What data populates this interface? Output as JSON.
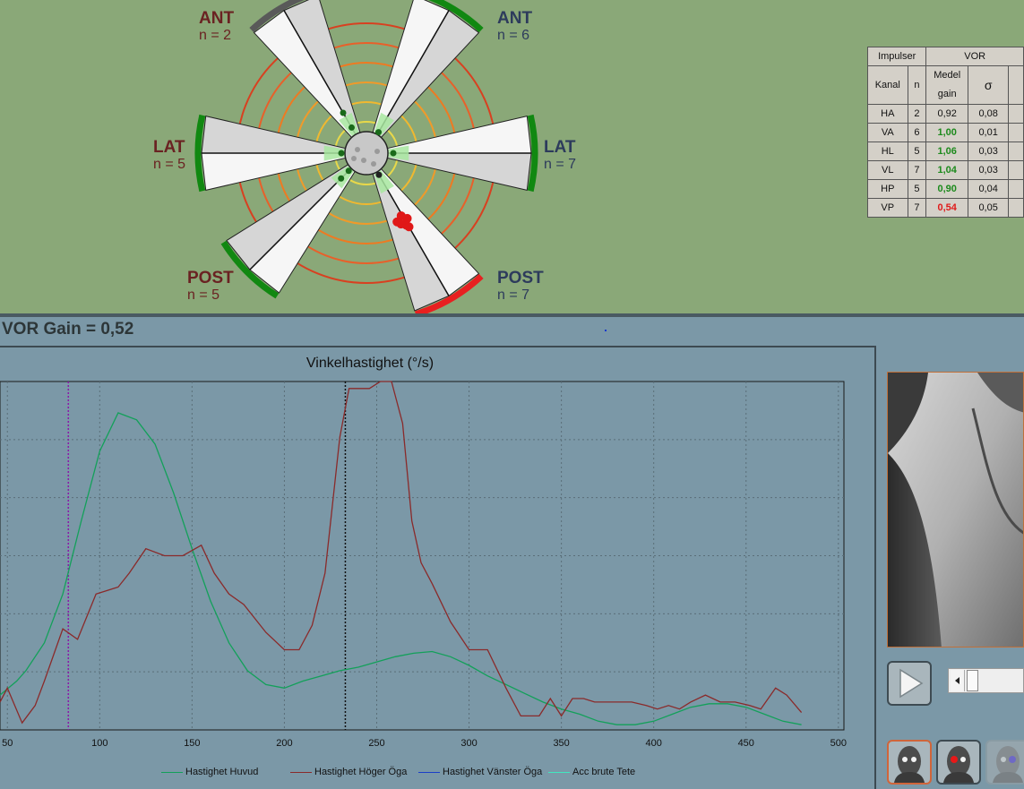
{
  "radar": {
    "labels": [
      {
        "name": "ANT",
        "n": "n = 2",
        "tone": "red"
      },
      {
        "name": "ANT",
        "n": "n = 6",
        "tone": "blue"
      },
      {
        "name": "LAT",
        "n": "n = 5",
        "tone": "red"
      },
      {
        "name": "LAT",
        "n": "n = 7",
        "tone": "blue"
      },
      {
        "name": "POST",
        "n": "n = 5",
        "tone": "red"
      },
      {
        "name": "POST",
        "n": "n = 7",
        "tone": "blue"
      }
    ],
    "arc_colors": [
      "#595959",
      "#118811",
      "#118811",
      "#118811",
      "#118811",
      "#e82020"
    ],
    "ring_colors": [
      "#e8d84a",
      "#f0b830",
      "#f09a2a",
      "#ee7a22",
      "#e8602a",
      "#d84020"
    ]
  },
  "stats": {
    "header": {
      "impulser": "Impulser",
      "vor": "VOR",
      "kanal": "Kanal",
      "n": "n",
      "medel_line1": "Medel",
      "medel_line2": "gain",
      "sigma": "σ"
    },
    "rows": [
      {
        "kanal": "HA",
        "n": "2",
        "gain": "0,92",
        "sigma": "0,08",
        "gain_color": "black"
      },
      {
        "kanal": "VA",
        "n": "6",
        "gain": "1,00",
        "sigma": "0,01",
        "gain_color": "green"
      },
      {
        "kanal": "HL",
        "n": "5",
        "gain": "1,06",
        "sigma": "0,03",
        "gain_color": "green"
      },
      {
        "kanal": "VL",
        "n": "7",
        "gain": "1,04",
        "sigma": "0,03",
        "gain_color": "green"
      },
      {
        "kanal": "HP",
        "n": "5",
        "gain": "0,90",
        "sigma": "0,04",
        "gain_color": "green"
      },
      {
        "kanal": "VP",
        "n": "7",
        "gain": "0,54",
        "sigma": "0,05",
        "gain_color": "red"
      }
    ]
  },
  "vor_gain_text": "VOR Gain = 0,52",
  "chart_data": {
    "type": "line",
    "title": "Vinkelhastighet (°/s)",
    "x_ticks": [
      50,
      100,
      150,
      200,
      250,
      300,
      350,
      400,
      450,
      500
    ],
    "xlim": [
      46,
      503
    ],
    "ylim": [
      0,
      100
    ],
    "markers": [
      {
        "x": 83,
        "color": "#8a1aa8"
      },
      {
        "x": 233,
        "color": "#111111"
      }
    ],
    "legend": [
      {
        "label": "Hastighet Huvud",
        "color": "#13a05a"
      },
      {
        "label": "Hastighet Höger Öga",
        "color": "#8a2a2a"
      },
      {
        "label": "Hastighet Vänster Öga",
        "color": "#1a3ec8"
      },
      {
        "label": "Acc brute Tete",
        "color": "#40e8c0"
      }
    ],
    "series": [
      {
        "name": "Hastighet Huvud",
        "color": "#13a05a",
        "x": [
          46,
          55,
          60,
          70,
          80,
          90,
          100,
          110,
          120,
          130,
          140,
          150,
          160,
          170,
          180,
          190,
          200,
          210,
          220,
          230,
          240,
          250,
          260,
          270,
          280,
          290,
          300,
          310,
          320,
          330,
          340,
          350,
          360,
          370,
          380,
          390,
          400,
          410,
          420,
          430,
          440,
          450,
          460,
          470,
          480
        ],
        "y": [
          10,
          14,
          17,
          25,
          39,
          60,
          80,
          91,
          89,
          82,
          68,
          52,
          37,
          25,
          17,
          13,
          12,
          14,
          15.5,
          17,
          18,
          19.5,
          21,
          22,
          22.5,
          21,
          18.5,
          15.5,
          13,
          10.5,
          8,
          6,
          4.5,
          2.5,
          1.5,
          1.5,
          2.5,
          4.5,
          6.5,
          7.5,
          7.5,
          6.5,
          4.5,
          2.5,
          1.5
        ]
      },
      {
        "name": "Hastighet Höger Öga",
        "color": "#8a2a2a",
        "x": [
          46,
          50,
          58,
          65,
          70,
          80,
          88,
          98,
          104,
          110,
          116,
          125,
          135,
          145,
          155,
          162,
          170,
          178,
          190,
          200,
          208,
          215,
          222,
          230,
          235,
          240,
          246,
          252,
          258,
          264,
          269,
          274,
          280,
          290,
          300,
          310,
          320,
          328,
          332,
          338,
          344,
          350,
          356,
          362,
          368,
          374,
          380,
          388,
          396,
          402,
          408,
          414,
          420,
          428,
          436,
          444,
          452,
          458,
          466,
          472,
          480
        ],
        "y": [
          8,
          12,
          2,
          7,
          14,
          29,
          26,
          39,
          40,
          41,
          45,
          52,
          50,
          50,
          53,
          45,
          39,
          36,
          28,
          23,
          23,
          30,
          45,
          84,
          98,
          98,
          98,
          100,
          100,
          88,
          60,
          48,
          42,
          31,
          23,
          23,
          12,
          4,
          4,
          4,
          9,
          4,
          9,
          9,
          8,
          8,
          8,
          8,
          7,
          6,
          7,
          6,
          8,
          10,
          8,
          8,
          7,
          6,
          12,
          10,
          5
        ]
      }
    ]
  }
}
